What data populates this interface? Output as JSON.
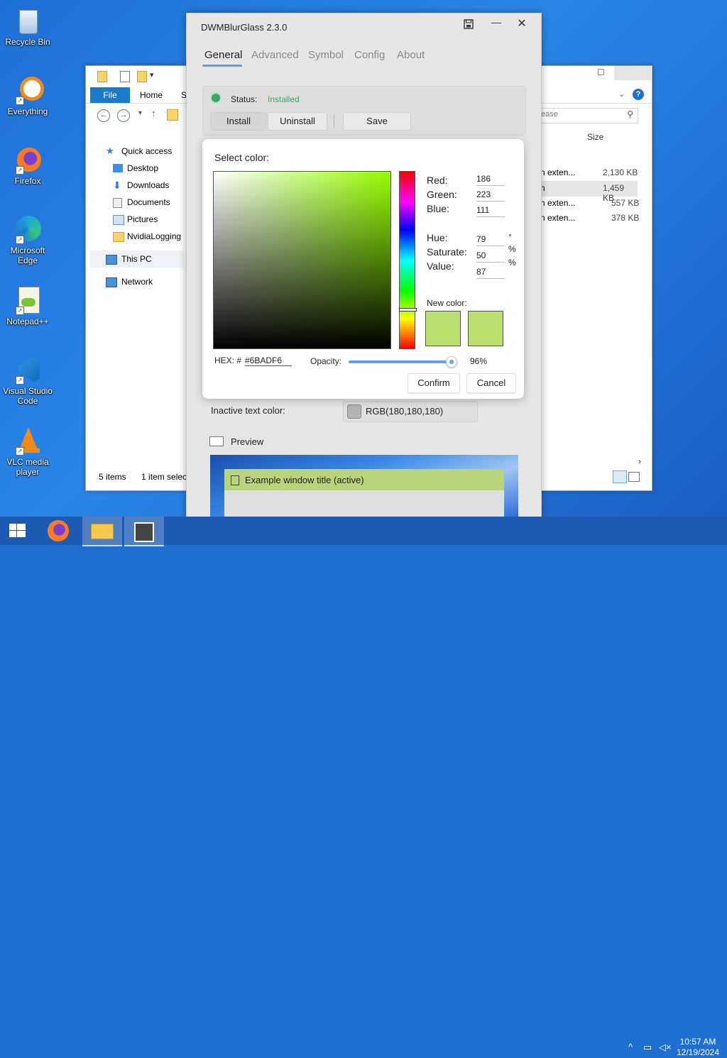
{
  "desktop": {
    "icons": [
      {
        "label": "Recycle Bin"
      },
      {
        "label": "Everything"
      },
      {
        "label": "Firefox"
      },
      {
        "label": "Microsoft Edge"
      },
      {
        "label": "Notepad++"
      },
      {
        "label": "Visual Studio Code"
      },
      {
        "label": "VLC media player"
      }
    ]
  },
  "explorer": {
    "ribbon": {
      "file": "File",
      "home": "Home",
      "share_partial": "S"
    },
    "search_placeholder_partial": "ease",
    "column_size": "Size",
    "tree": [
      {
        "label": "Quick access"
      },
      {
        "label": "Desktop"
      },
      {
        "label": "Downloads"
      },
      {
        "label": "Documents"
      },
      {
        "label": "Pictures"
      },
      {
        "label": "NvidiaLogging"
      },
      {
        "label": "This PC"
      },
      {
        "label": "Network"
      }
    ],
    "rows": [
      {
        "type": "n exten...",
        "size": "2,130 KB"
      },
      {
        "type": "n",
        "size": "1,459 KB"
      },
      {
        "type": "n exten...",
        "size": "557 KB"
      },
      {
        "type": "n exten...",
        "size": "378 KB"
      }
    ],
    "status_items": "5 items",
    "status_selected": "1 item selec"
  },
  "dwm": {
    "title": "DWMBlurGlass 2.3.0",
    "tabs": [
      "General",
      "Advanced",
      "Symbol",
      "Config",
      "About"
    ],
    "status_label": "Status:",
    "status_value": "Installed",
    "buttons": {
      "install": "Install",
      "uninstall": "Uninstall",
      "save": "Save"
    },
    "inactive_label": "Inactive text color:",
    "inactive_value": "RGB(180,180,180)",
    "preview_label": "Preview",
    "preview_window_title": "Example window title (active)"
  },
  "picker": {
    "title": "Select color:",
    "red_label": "Red:",
    "red": "186",
    "green_label": "Green:",
    "green": "223",
    "blue_label": "Blue:",
    "blue": "111",
    "hue_label": "Hue:",
    "hue": "79",
    "hue_unit": "°",
    "sat_label": "Saturate:",
    "sat": "50",
    "sat_unit": "%",
    "val_label": "Value:",
    "val": "87",
    "val_unit": "%",
    "new_color_label": "New color:",
    "hex_label": "HEX: #",
    "hex_value": "#6BADF6",
    "opacity_label": "Opacity:",
    "opacity_value": "96%",
    "opacity_fraction": 0.96,
    "confirm": "Confirm",
    "cancel": "Cancel",
    "swatch_color": "#badf6f"
  },
  "taskbar": {
    "time": "10:57 AM",
    "date": "12/19/2024"
  }
}
